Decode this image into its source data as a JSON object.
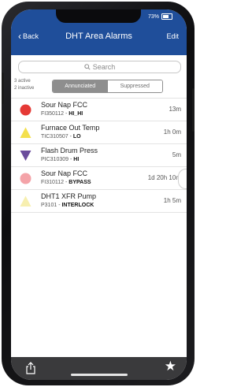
{
  "status": {
    "time": "",
    "battery": "73%"
  },
  "nav": {
    "back_label": "Back",
    "title": "DHT Area Alarms",
    "edit_label": "Edit"
  },
  "search": {
    "placeholder": "Search"
  },
  "counts": {
    "active": "3 active",
    "inactive": "2 inactive"
  },
  "tabs": [
    {
      "label": "Annunciated",
      "selected": true
    },
    {
      "label": "Suppressed",
      "selected": false
    }
  ],
  "alarms": [
    {
      "name": "Sour Nap FCC",
      "tag": "FI350112",
      "type": "HI_HI",
      "time": "13m",
      "icon": "circle-icon",
      "color": "#e53935",
      "active": true
    },
    {
      "name": "Furnace Out Temp",
      "tag": "TIC310507",
      "type": "LO",
      "time": "1h 0m",
      "icon": "triangle-icon",
      "color": "#f4e04d",
      "active": true
    },
    {
      "name": "Flash Drum Press",
      "tag": "PIC310309",
      "type": "HI",
      "time": "5m",
      "icon": "triangle-down-icon",
      "color": "#6a4c9c",
      "active": true
    },
    {
      "name": "Sour Nap FCC",
      "tag": "FI310112",
      "type": "BYPASS",
      "time": "1d 20h 10m",
      "icon": "circle-icon",
      "color": "#f4a3a8",
      "active": false
    },
    {
      "name": "DHT1 XFR Pump",
      "tag": "P3101",
      "type": "INTERLOCK",
      "time": "1h 5m",
      "icon": "triangle-icon",
      "color": "#f7efb0",
      "active": false
    }
  ],
  "footer": {
    "share_icon": "share-icon",
    "favorite_icon": "star-icon"
  }
}
